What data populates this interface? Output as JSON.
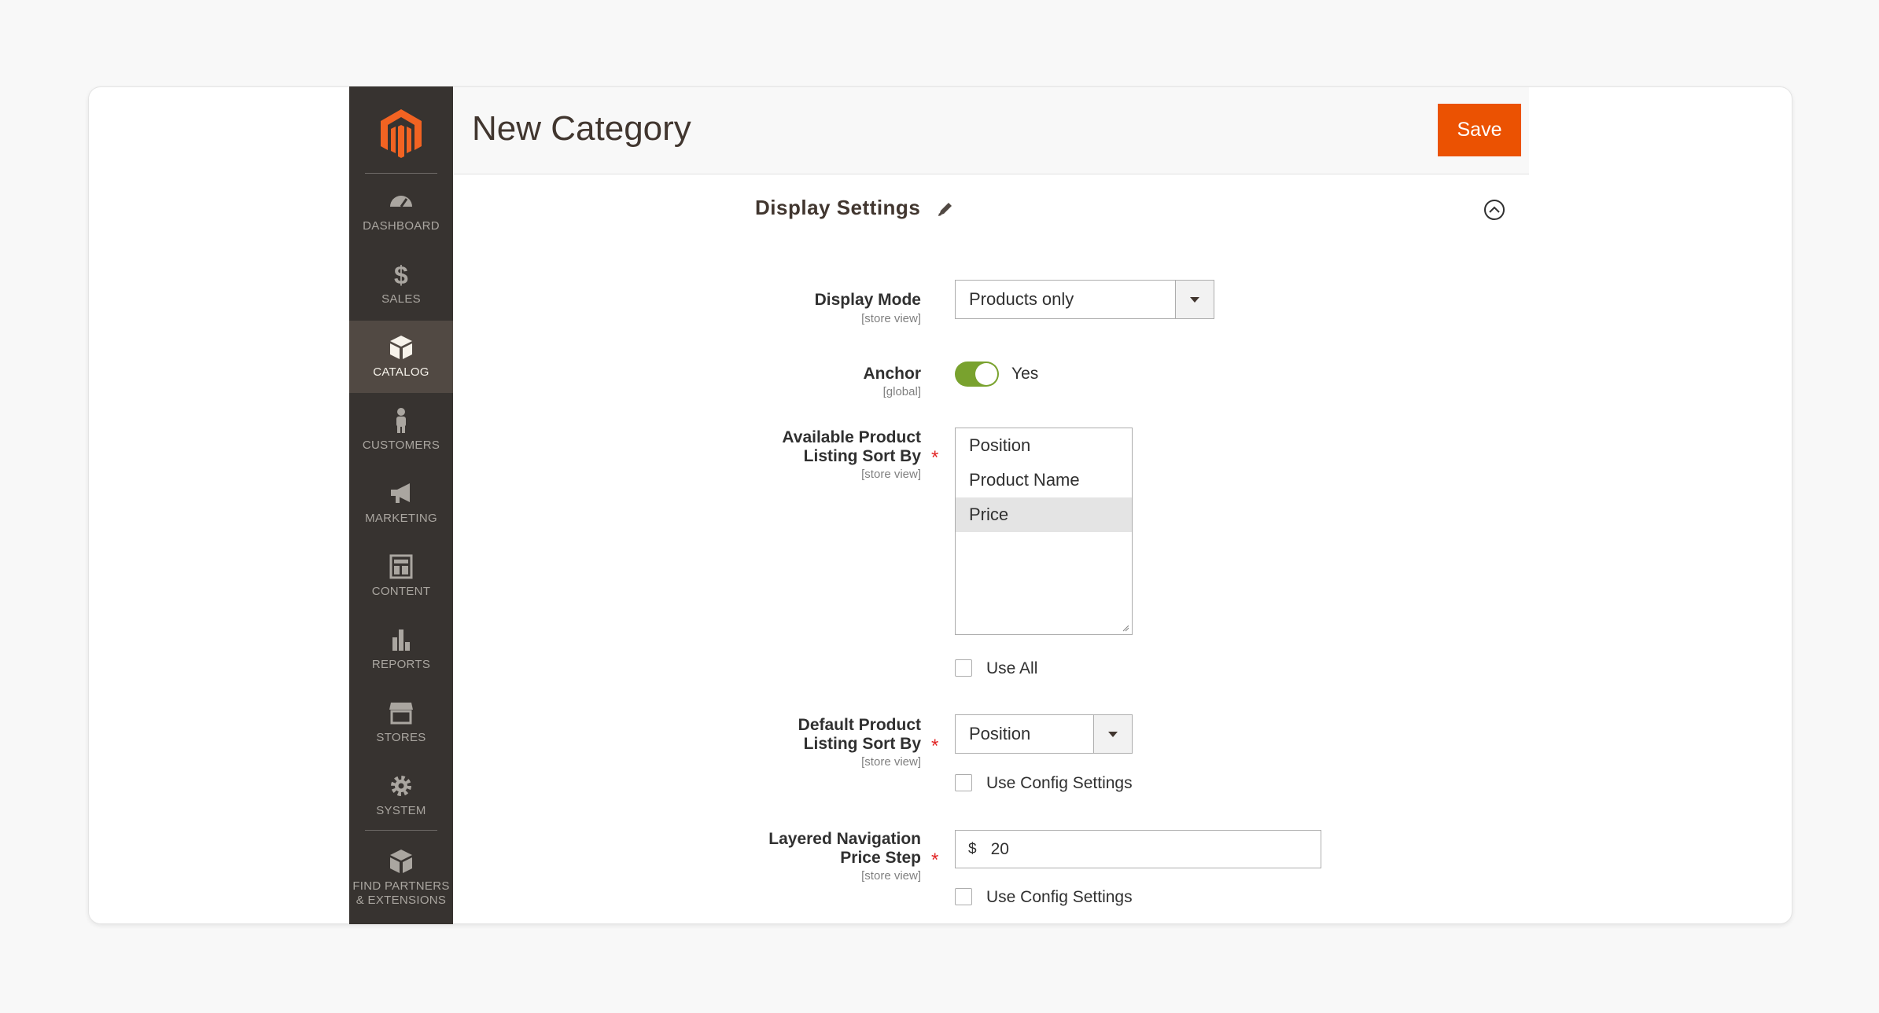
{
  "sidebar": {
    "items": [
      {
        "label": "DASHBOARD",
        "icon": "dashboard-icon"
      },
      {
        "label": "SALES",
        "icon": "dollar-icon"
      },
      {
        "label": "CATALOG",
        "icon": "cube-icon"
      },
      {
        "label": "CUSTOMERS",
        "icon": "person-icon"
      },
      {
        "label": "MARKETING",
        "icon": "megaphone-icon"
      },
      {
        "label": "CONTENT",
        "icon": "layout-icon"
      },
      {
        "label": "REPORTS",
        "icon": "bar-chart-icon"
      },
      {
        "label": "STORES",
        "icon": "storefront-icon"
      },
      {
        "label": "SYSTEM",
        "icon": "gear-icon"
      },
      {
        "label": "FIND PARTNERS",
        "label2": "& EXTENSIONS",
        "icon": "box-icon"
      }
    ]
  },
  "header": {
    "title": "New Category",
    "save_label": "Save"
  },
  "section": {
    "title": "Display Settings"
  },
  "fields": {
    "display_mode": {
      "label": "Display Mode",
      "scope": "[store view]",
      "value": "Products only"
    },
    "anchor": {
      "label": "Anchor",
      "scope": "[global]",
      "value": "Yes",
      "on": true
    },
    "available_sort": {
      "label1": "Available Product",
      "label2": "Listing Sort By",
      "scope": "[store view]",
      "options": [
        "Position",
        "Product Name",
        "Price"
      ],
      "selected": "Price",
      "use_all_label": "Use All"
    },
    "default_sort": {
      "label1": "Default Product",
      "label2": "Listing Sort By",
      "scope": "[store view]",
      "value": "Position",
      "use_config_label": "Use Config Settings"
    },
    "price_step": {
      "label1": "Layered Navigation",
      "label2": "Price Step",
      "scope": "[store view]",
      "prefix": "$",
      "value": "20",
      "use_config_label": "Use Config Settings"
    }
  },
  "colors": {
    "accent": "#eb5202",
    "sidebar": "#373330",
    "toggle_on": "#79a22e"
  }
}
